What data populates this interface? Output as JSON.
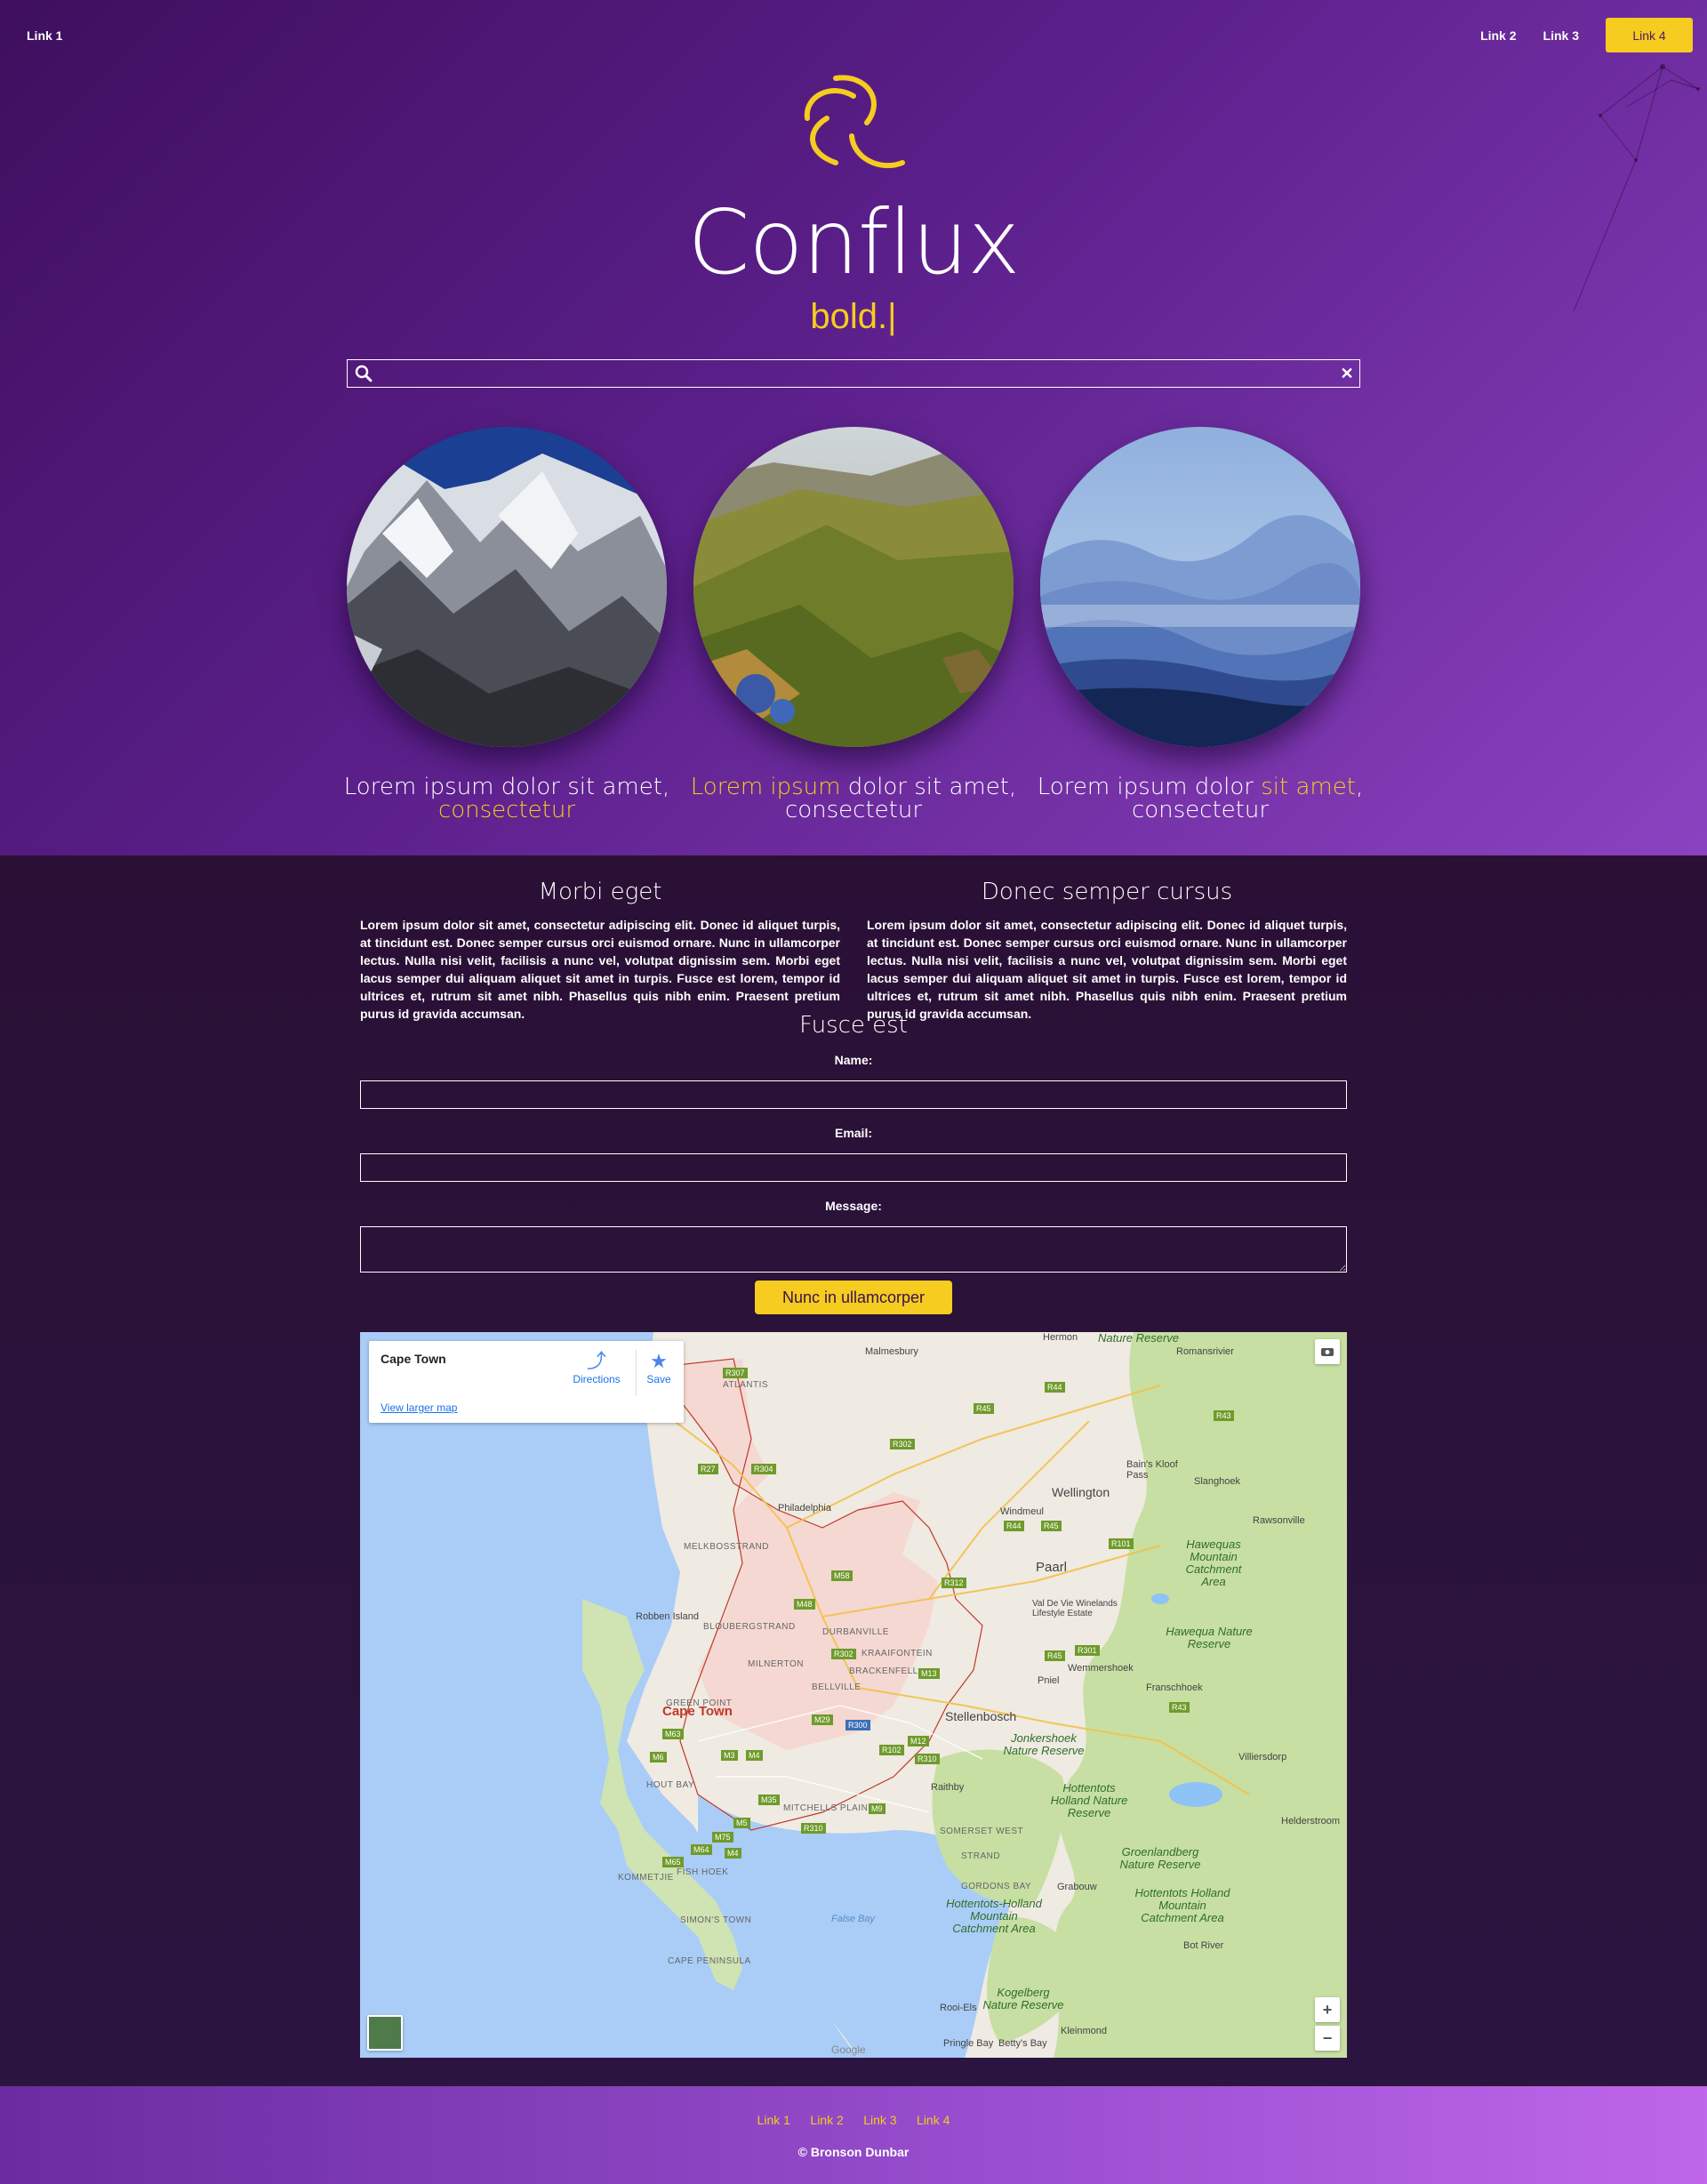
{
  "nav": {
    "left": "Link 1",
    "right": [
      "Link 2",
      "Link 3",
      "Link 4"
    ]
  },
  "hero": {
    "brand": "Conflux",
    "tagline": "bold.|",
    "search": {
      "value": "",
      "placeholder": ""
    }
  },
  "cards": [
    {
      "image": "snowy-mountain",
      "parts": [
        {
          "text": "Lorem ipsum dolor sit amet,",
          "hl": false
        },
        {
          "text": "consectetur",
          "hl": true
        }
      ]
    },
    {
      "image": "green-valley",
      "parts": [
        {
          "text": "Lorem ipsum",
          "hl": true
        },
        {
          "text": " dolor sit amet,",
          "hl": false
        },
        {
          "text": "consectetur",
          "hl": false
        }
      ]
    },
    {
      "image": "misty-hills",
      "parts": [
        {
          "text": "Lorem ipsum dolor ",
          "hl": false
        },
        {
          "text": "sit amet",
          "hl": true
        },
        {
          "text": ",",
          "hl": false
        },
        {
          "text": "consectetur",
          "hl": false
        }
      ]
    }
  ],
  "columns": [
    {
      "title": "Morbi eget",
      "text": "Lorem ipsum dolor sit amet, consectetur adipiscing elit. Donec id aliquet turpis, at tincidunt est. Donec semper cursus orci euismod ornare. Nunc in ullamcorper lectus. Nulla nisi velit, facilisis a nunc vel, volutpat dignissim sem. Morbi eget lacus semper dui aliquam aliquet sit amet in turpis. Fusce est lorem, tempor id ultrices et, rutrum sit amet nibh. Phasellus quis nibh enim. Praesent pretium purus id gravida accumsan."
    },
    {
      "title": "Donec semper cursus",
      "text": "Lorem ipsum dolor sit amet, consectetur adipiscing elit. Donec id aliquet turpis, at tincidunt est. Donec semper cursus orci euismod ornare. Nunc in ullamcorper lectus. Nulla nisi velit, facilisis a nunc vel, volutpat dignissim sem. Morbi eget lacus semper dui aliquam aliquet sit amet in turpis. Fusce est lorem, tempor id ultrices et, rutrum sit amet nibh. Phasellus quis nibh enim. Praesent pretium purus id gravida accumsan."
    }
  ],
  "form": {
    "title": "Fusce est",
    "name_label": "Name:",
    "email_label": "Email:",
    "message_label": "Message:",
    "name_value": "",
    "email_value": "",
    "message_value": "",
    "submit": "Nunc in ullamcorper"
  },
  "map": {
    "place": "Cape Town",
    "directions": "Directions",
    "save": "Save",
    "larger": "View larger map",
    "zoom_in": "+",
    "zoom_out": "−",
    "google": "Google",
    "city_label": "Cape Town",
    "labels": [
      "Malmesbury",
      "Hermon",
      "Romansrivier",
      "Wellington",
      "Bain's Kloof Pass",
      "Slanghoek",
      "Rawsonville",
      "Windmeul",
      "Paarl",
      "Philadelphia",
      "MELKBOSSTRAND",
      "Robben Island",
      "BLOUBERGSTRAND",
      "DURBANVILLE",
      "KRAAIFONTEIN",
      "MILNERTON",
      "BRACKENFELL",
      "BELLVILLE",
      "Val De Vie Winelands Lifestyle Estate",
      "Wemmershoek",
      "Pniel",
      "Franschhoek",
      "Stellenbosch",
      "Villiersdorp",
      "Raithby",
      "HOUT BAY",
      "MITCHELLS PLAIN",
      "SOMERSET WEST",
      "STRAND",
      "Helderstroom",
      "GORDONS BAY",
      "Grabouw",
      "KOMMETJIE",
      "FISH HOEK",
      "False Bay",
      "SIMON'S TOWN",
      "CAPE PENINSULA",
      "Bot River",
      "Rooi-Els",
      "Kleinmond",
      "Pringle Bay",
      "Betty's Bay",
      "ATLANTIS",
      "GREEN POINT"
    ],
    "parks": [
      "Nature Reserve",
      "Hawequas Mountain Catchment Area",
      "Hawequa Nature Reserve",
      "Jonkershoek Nature Reserve",
      "Hottentots Holland Nature Reserve",
      "Groenlandberg Nature Reserve",
      "Hottentots Holland Mountain Catchment Area",
      "Hottentots-Holland Mountain Catchment Area",
      "Kogelberg Nature Reserve"
    ],
    "roads": [
      "R307",
      "R304",
      "R302",
      "R44",
      "R45",
      "R43",
      "R27",
      "R101",
      "M58",
      "R312",
      "M48",
      "R302",
      "M13",
      "M12",
      "R310",
      "M3",
      "M4",
      "M5",
      "M63",
      "M65",
      "M75",
      "M64",
      "M6",
      "R102",
      "M29",
      "R300",
      "M9",
      "M35",
      "R310",
      "M4",
      "R44",
      "R45",
      "R301",
      "R45",
      "R43"
    ]
  },
  "footer": {
    "links": [
      "Link 1",
      "Link 2",
      "Link 3",
      "Link 4"
    ],
    "copyright": "© Bronson Dunbar"
  },
  "colors": {
    "accent": "#f5cc1f",
    "hero_start": "#3f0f5e",
    "hero_end": "#8b42c0",
    "content_bg": "#2a1338"
  }
}
